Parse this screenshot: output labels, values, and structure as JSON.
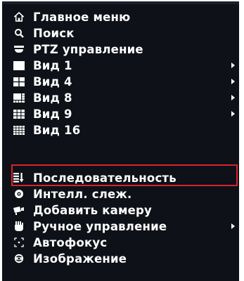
{
  "menu": {
    "items": [
      {
        "label": "Главное меню",
        "icon": "home-icon",
        "submenu": false
      },
      {
        "label": "Поиск",
        "icon": "search-icon",
        "submenu": false
      },
      {
        "label": "PTZ управление",
        "icon": "ptz-camera-icon",
        "submenu": false
      },
      {
        "label": "Вид 1",
        "icon": "view-1-icon",
        "submenu": true
      },
      {
        "label": "Вид 4",
        "icon": "view-4-icon",
        "submenu": true
      },
      {
        "label": "Вид 8",
        "icon": "view-8-icon",
        "submenu": true
      },
      {
        "label": "Вид 9",
        "icon": "view-9-icon",
        "submenu": true
      },
      {
        "label": "Вид 16",
        "icon": "view-16-icon",
        "submenu": false
      },
      {
        "label": "Последовательность",
        "icon": "sequence-icon",
        "submenu": false,
        "highlighted": true
      },
      {
        "label": "Интелл. слеж.",
        "icon": "smart-tracking-icon",
        "submenu": false
      },
      {
        "label": "Добавить камеру",
        "icon": "add-camera-icon",
        "submenu": false
      },
      {
        "label": "Ручное управление",
        "icon": "manual-control-icon",
        "submenu": true
      },
      {
        "label": "Автофокус",
        "icon": "autofocus-icon",
        "submenu": false
      },
      {
        "label": "Изображение",
        "icon": "image-icon",
        "submenu": false
      }
    ]
  },
  "colors": {
    "menu_background": "#0e1118",
    "text": "#ffffff",
    "highlight_border": "#d8232a"
  }
}
